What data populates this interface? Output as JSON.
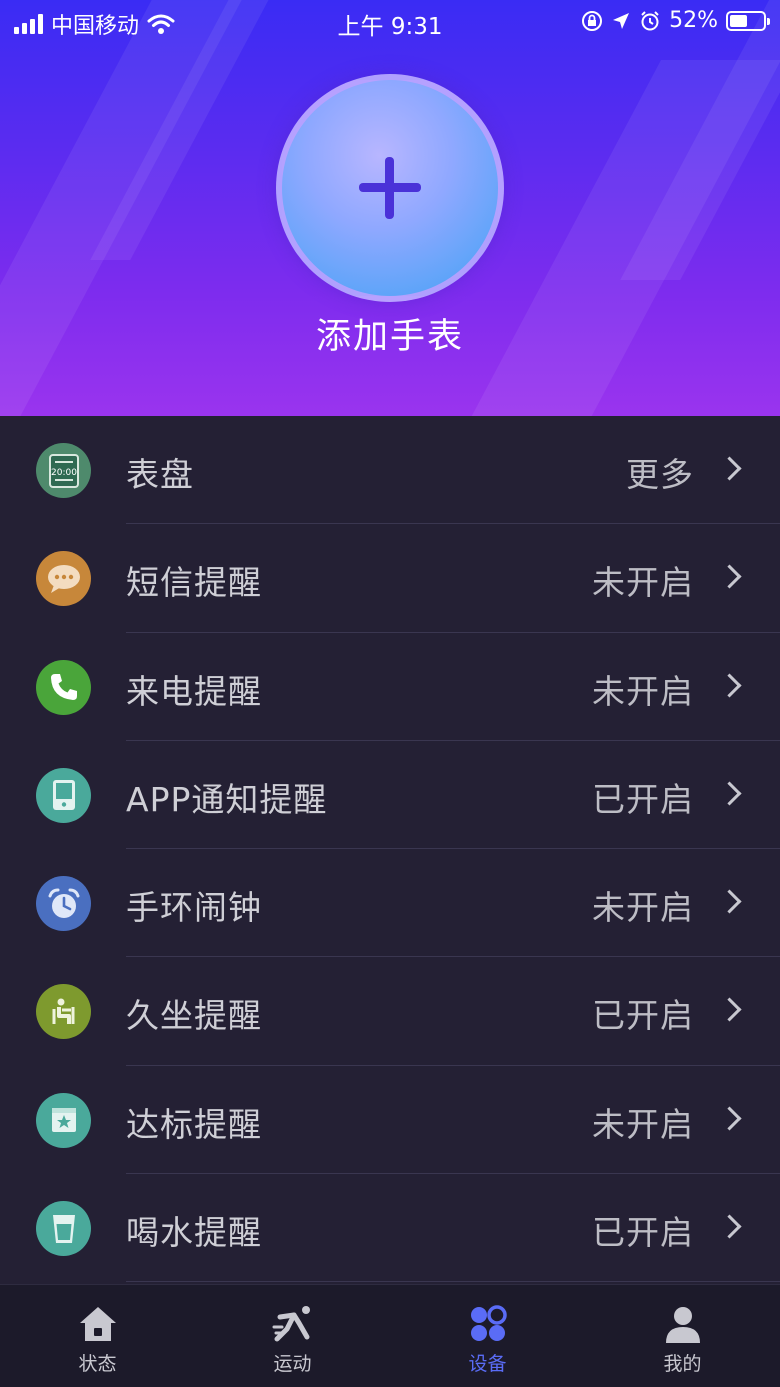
{
  "status_bar": {
    "carrier": "中国移动",
    "time": "上午 9:31",
    "battery_percent": "52%",
    "battery_level": 0.52
  },
  "header": {
    "add_label": "添加手表",
    "add_icon": "plus-icon",
    "gradient_colors": [
      "#3a2cf4",
      "#9a34ee"
    ]
  },
  "list": {
    "items": [
      {
        "label": "表盘",
        "value": "更多",
        "icon": "watch-face-icon",
        "icon_bg": "#4e8a6c"
      },
      {
        "label": "短信提醒",
        "value": "未开启",
        "icon": "message-icon",
        "icon_bg": "#c7873a"
      },
      {
        "label": "来电提醒",
        "value": "未开启",
        "icon": "phone-icon",
        "icon_bg": "#4aa53a"
      },
      {
        "label": "APP通知提醒",
        "value": "已开启",
        "icon": "app-notification-icon",
        "icon_bg": "#4aa99b"
      },
      {
        "label": "手环闹钟",
        "value": "未开启",
        "icon": "alarm-clock-icon",
        "icon_bg": "#4a6fc0"
      },
      {
        "label": "久坐提醒",
        "value": "已开启",
        "icon": "sedentary-icon",
        "icon_bg": "#7e9a2e"
      },
      {
        "label": "达标提醒",
        "value": "未开启",
        "icon": "goal-icon",
        "icon_bg": "#4aa99b"
      },
      {
        "label": "喝水提醒",
        "value": "已开启",
        "icon": "water-cup-icon",
        "icon_bg": "#4aa99b"
      }
    ]
  },
  "tabbar": {
    "tabs": [
      {
        "label": "状态",
        "icon": "home-icon",
        "active": false
      },
      {
        "label": "运动",
        "icon": "running-icon",
        "active": false
      },
      {
        "label": "设备",
        "icon": "device-grid-icon",
        "active": true
      },
      {
        "label": "我的",
        "icon": "profile-icon",
        "active": false
      }
    ],
    "active_color": "#5a6cf6"
  },
  "watch_face_text": "20:00"
}
